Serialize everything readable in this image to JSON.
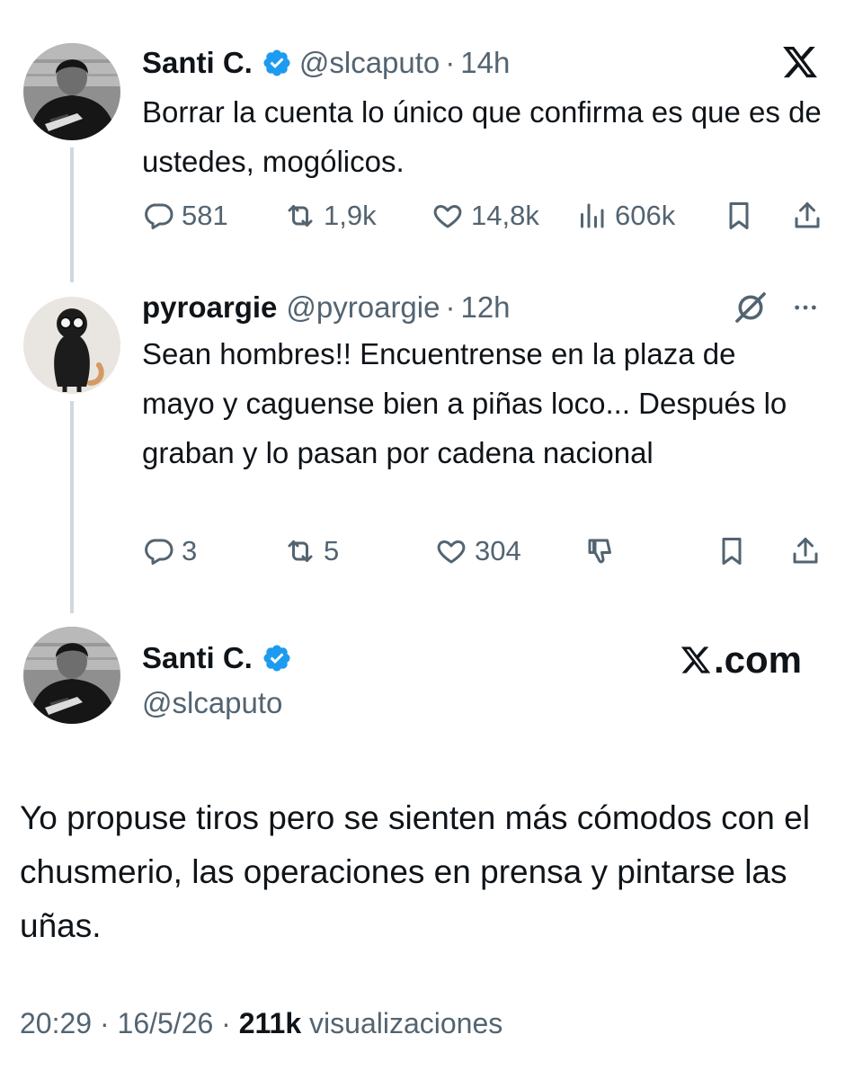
{
  "tweet1": {
    "name": "Santi C.",
    "handle": "@slcaputo",
    "separator": "·",
    "time": "14h",
    "text": "Borrar la cuenta lo único que confirma es que es de ustedes, mogólicos.",
    "stats": {
      "replies": "581",
      "reposts": "1,9k",
      "likes": "14,8k",
      "views": "606k"
    },
    "icons": [
      "x-logo-icon",
      "verified-badge-icon",
      "reply-icon",
      "repost-icon",
      "like-icon",
      "views-icon",
      "bookmark-icon",
      "share-icon"
    ]
  },
  "tweet2": {
    "name": "pyroargie",
    "handle": "@pyroargie",
    "separator": "·",
    "time": "12h",
    "text": "Sean hombres!! Encuentrense en la plaza de mayo y caguense bien a piñas loco... Después lo graban y lo pasan por cadena nacional",
    "stats": {
      "replies": "3",
      "reposts": "5",
      "likes": "304"
    },
    "icons": [
      "grok-icon",
      "more-icon",
      "reply-icon",
      "repost-icon",
      "like-icon",
      "dislike-icon",
      "bookmark-icon",
      "share-icon"
    ]
  },
  "tweet3": {
    "name": "Santi C.",
    "handle": "@slcaputo",
    "brand": ".com",
    "text": "Yo propuse tiros pero se sienten más cómodos con el chusmerio, las operaciones en prensa y pintarse las uñas.",
    "time": "20:29",
    "separator": "·",
    "date": "16/5/26",
    "views_count": "211k",
    "views_label": "visualizaciones"
  },
  "colors": {
    "text": "#0f1419",
    "secondary": "#536471",
    "verified": "#1d9bf0",
    "thread_line": "#cfd9de"
  }
}
